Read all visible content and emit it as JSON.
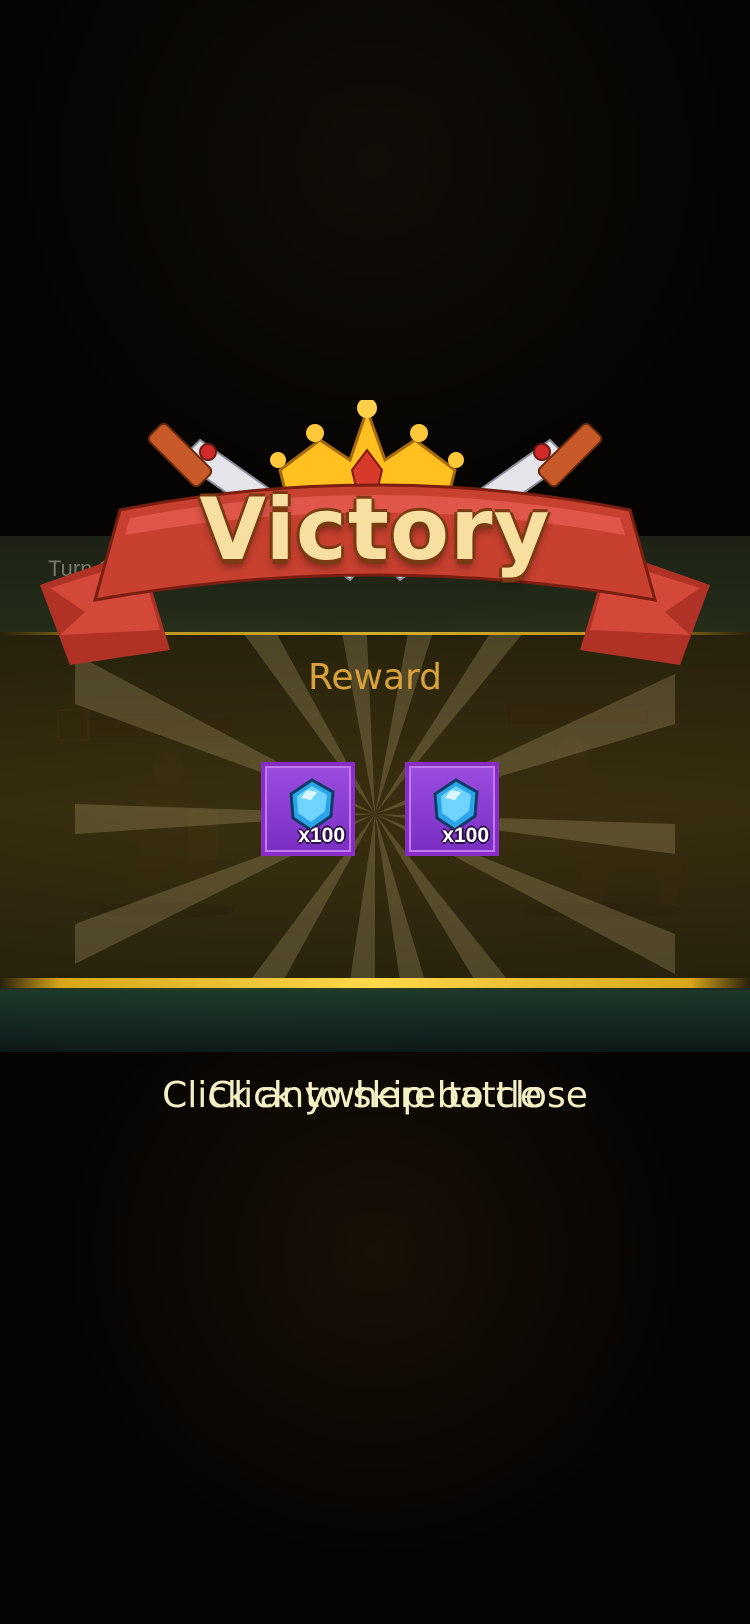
{
  "battle": {
    "turn_label": "Turn 1"
  },
  "banner": {
    "title": "Victory"
  },
  "reward": {
    "title": "Reward",
    "items": [
      {
        "icon": "blue-gem-icon",
        "quantity": "x100"
      },
      {
        "icon": "blue-gem-icon",
        "quantity": "x100"
      }
    ]
  },
  "prompts": {
    "close": "Click anywhere to close",
    "skip": "Click to skip battle"
  },
  "colors": {
    "banner_red": "#c8402f",
    "gold": "#d8a13a",
    "slot_purple": "#8a2cc8",
    "prompt_text": "#f4f0c4"
  }
}
